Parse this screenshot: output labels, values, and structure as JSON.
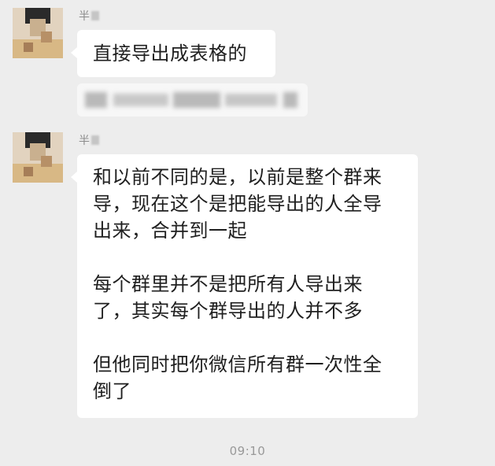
{
  "chat": {
    "messages": [
      {
        "sender": "半",
        "text": "直接导出成表格的"
      },
      {
        "sender": "半",
        "paragraphs": [
          [
            "和以前不同的是，以前是整个群来",
            "导，现在这个是把能导出的人全导",
            "出来，合并到一起"
          ],
          [
            "每个群里并不是把所有人导出来",
            "了，其实每个群导出的人并不多"
          ],
          [
            "但他同时把你微信所有群一次性全",
            "倒了"
          ]
        ]
      }
    ],
    "timestamp": "09:10"
  },
  "colors": {
    "background": "#ededed",
    "bubble": "#ffffff",
    "text": "#1f1f1f",
    "meta": "#8b8b8b"
  },
  "icons": {
    "avatar": "pixelated-avatar"
  }
}
